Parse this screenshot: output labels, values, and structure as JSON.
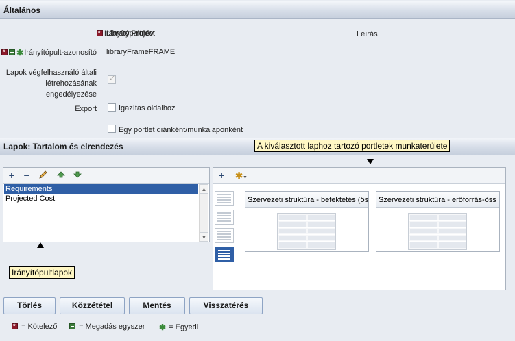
{
  "sections": {
    "general": "Általános",
    "pages": "Lapok: Tartalom és elrendezés"
  },
  "form": {
    "name_label": "Irányítópultnév",
    "name_value": "Library Project",
    "description_label": "Leírás",
    "id_label": "Irányítópult-azonosító",
    "id_value": "libraryFrameFRAME",
    "enduser_label_1": "Lapok végfelhasználó általi",
    "enduser_label_2": "létrehozásának",
    "enduser_label_3": "engedélyezése",
    "enduser_checked": true,
    "export_label": "Export",
    "export_fit_label": "Igazítás oldalhoz",
    "export_fit_checked": false,
    "export_slide_label": "Egy portlet diánként/munkalaponként",
    "export_slide_checked": false
  },
  "pages_list": {
    "items": [
      "Requirements",
      "Projected Cost"
    ],
    "selected_index": 0
  },
  "workspace": {
    "portlets": [
      "Szervezeti struktúra - befektetés (ös",
      "Szervezeti struktúra - erőforrás-öss"
    ],
    "active_layout_index": 3
  },
  "callouts": {
    "workspace": "A kiválasztott laphoz tartozó portletek munkaterülete",
    "pages": "Irányítópultlapok"
  },
  "buttons": {
    "delete": "Törlés",
    "publish": "Közzététel",
    "save": "Mentés",
    "return": "Visszatérés"
  },
  "legend": {
    "required": "= Kötelező",
    "once": "= Megadás egyszer",
    "unique": "= Egyedi"
  },
  "icons": {
    "add": "plus-icon",
    "remove": "minus-icon",
    "edit": "pencil-icon",
    "up": "arrow-up-icon",
    "down": "arrow-down-icon",
    "add_portlet": "plus-icon",
    "options": "gear-icon"
  },
  "colors": {
    "selection": "#2f5fa6",
    "callout_bg": "#fff7c4",
    "required": "#8c1a2b",
    "once": "#3b7a3b"
  }
}
